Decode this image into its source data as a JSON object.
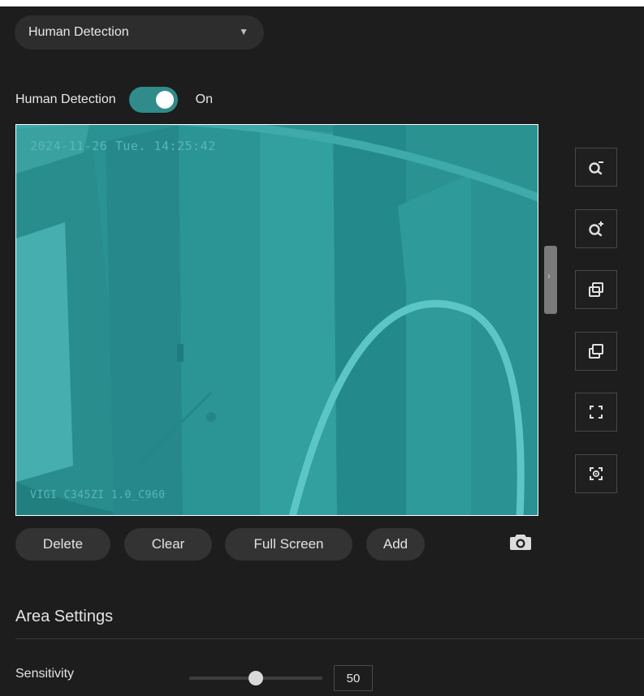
{
  "detection_dropdown": {
    "selected": "Human Detection"
  },
  "detection_toggle": {
    "label": "Human Detection",
    "state": "On",
    "enabled": true
  },
  "video": {
    "timestamp": "2024-11-26 Tue. 14:25:42",
    "camera_model": "VIGI C345ZI 1.0_C960"
  },
  "toolbar_icons": [
    "zoom-out-icon",
    "zoom-in-icon",
    "layer-up-icon",
    "layer-down-icon",
    "fullscreen-icon",
    "focus-icon"
  ],
  "actions": {
    "delete_label": "Delete",
    "clear_label": "Clear",
    "fullscreen_label": "Full Screen",
    "add_label": "Add"
  },
  "area_settings": {
    "title": "Area Settings",
    "sensitivity_label": "Sensitivity",
    "sensitivity_value": "50",
    "sensitivity_fraction": 0.5
  },
  "colors": {
    "accent": "#2f8c8b",
    "video_tint": "#2b9292",
    "background": "#1d1d1d"
  }
}
